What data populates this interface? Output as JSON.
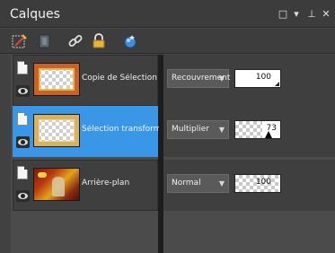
{
  "panel": {
    "title": "Calques"
  },
  "title_buttons": [
    {
      "icon": "maximize-icon",
      "symbol": "□"
    },
    {
      "icon": "dropdown-icon",
      "symbol": "▾"
    },
    {
      "icon": "pin-icon",
      "symbol": "⊥"
    },
    {
      "icon": "close-icon",
      "symbol": "✕"
    }
  ],
  "toolbar": [
    {
      "icon": "new-raster-layer-icon"
    },
    {
      "icon": "new-mask-icon"
    },
    {
      "icon": "link-icon"
    },
    {
      "icon": "lock-icon"
    },
    {
      "icon": "layer-style-icon"
    }
  ],
  "layers": [
    {
      "name": "Copie de Sélection tra",
      "blend_mode": "Recouvrement",
      "opacity": "100",
      "selected": false
    },
    {
      "name": "Sélection transformée",
      "blend_mode": "Multiplier",
      "opacity": "73",
      "selected": true
    },
    {
      "name": "Arrière-plan",
      "blend_mode": "Normal",
      "opacity": "100",
      "selected": false
    }
  ],
  "colors": {
    "selection": "#3a97e8",
    "panel_bg": "#474747"
  }
}
